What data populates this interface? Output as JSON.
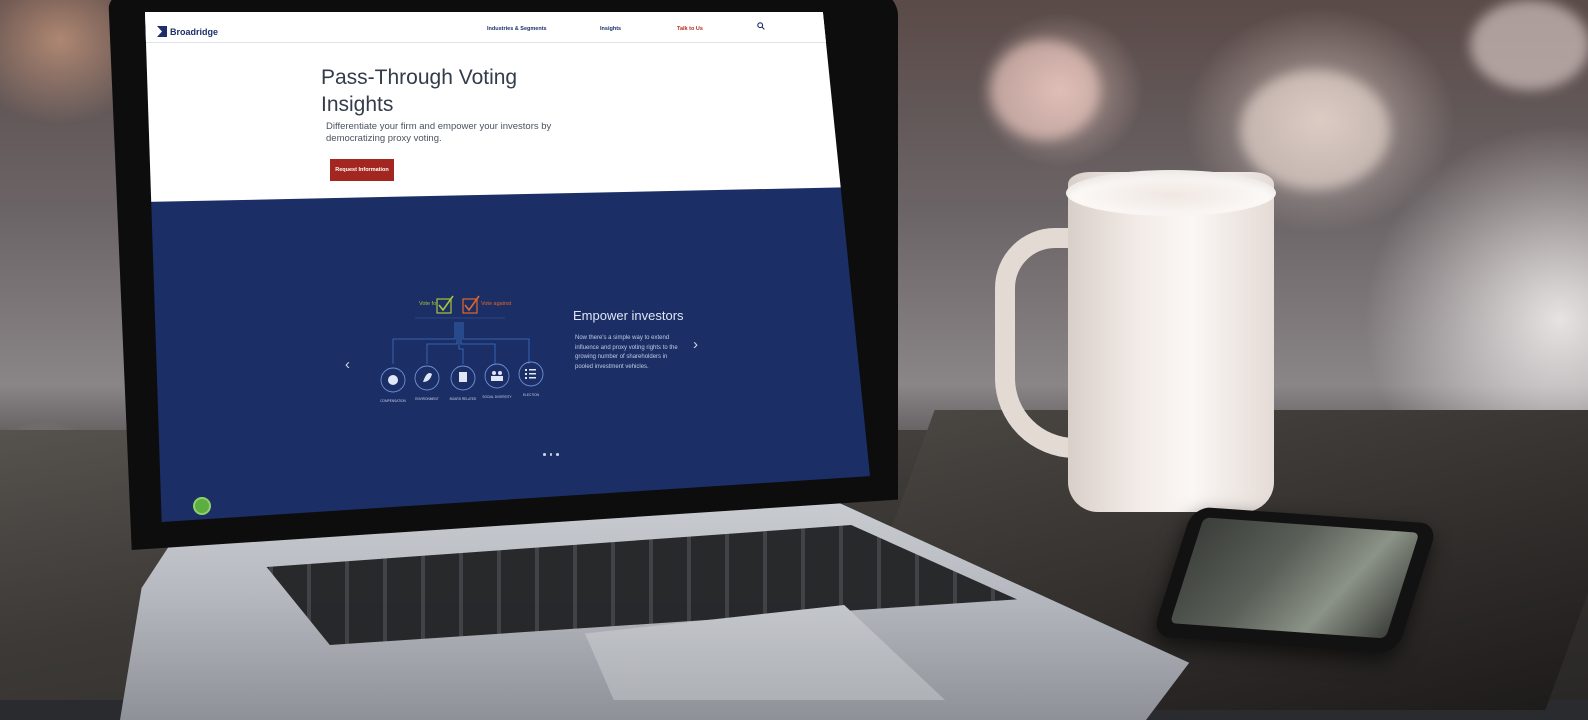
{
  "website": {
    "logo_text": "Broadridge",
    "nav": {
      "items": [
        "Industries & Segments",
        "Insights",
        "Talk to Us"
      ]
    },
    "hero": {
      "title": "Pass-Through Voting Insights",
      "subtitle": "Differentiate your firm and empower your investors by democratizing proxy voting.",
      "cta_label": "Request Information"
    },
    "carousel": {
      "slide_title": "Empower investors",
      "slide_body": "Now there's a simple way to extend influence and proxy voting rights to the growing number of shareholders in pooled investment vehicles.",
      "diagram": {
        "vote_for_label": "Vote for",
        "vote_against_label": "Vote against",
        "topics": [
          "COMPENSATION",
          "ENVIRONMENT",
          "BOARD RELATED",
          "SOCIAL DIVERSITY",
          "ELECTION"
        ]
      },
      "dot_count": 3,
      "prev_icon": "chevron-left-icon",
      "next_icon": "chevron-right-icon"
    },
    "colors": {
      "navy": "#1b2f66",
      "cta_red": "#a32620",
      "talk_link_red": "#b32d24",
      "vote_for_green": "#a8c43a",
      "vote_against_orange": "#e0662a"
    }
  }
}
